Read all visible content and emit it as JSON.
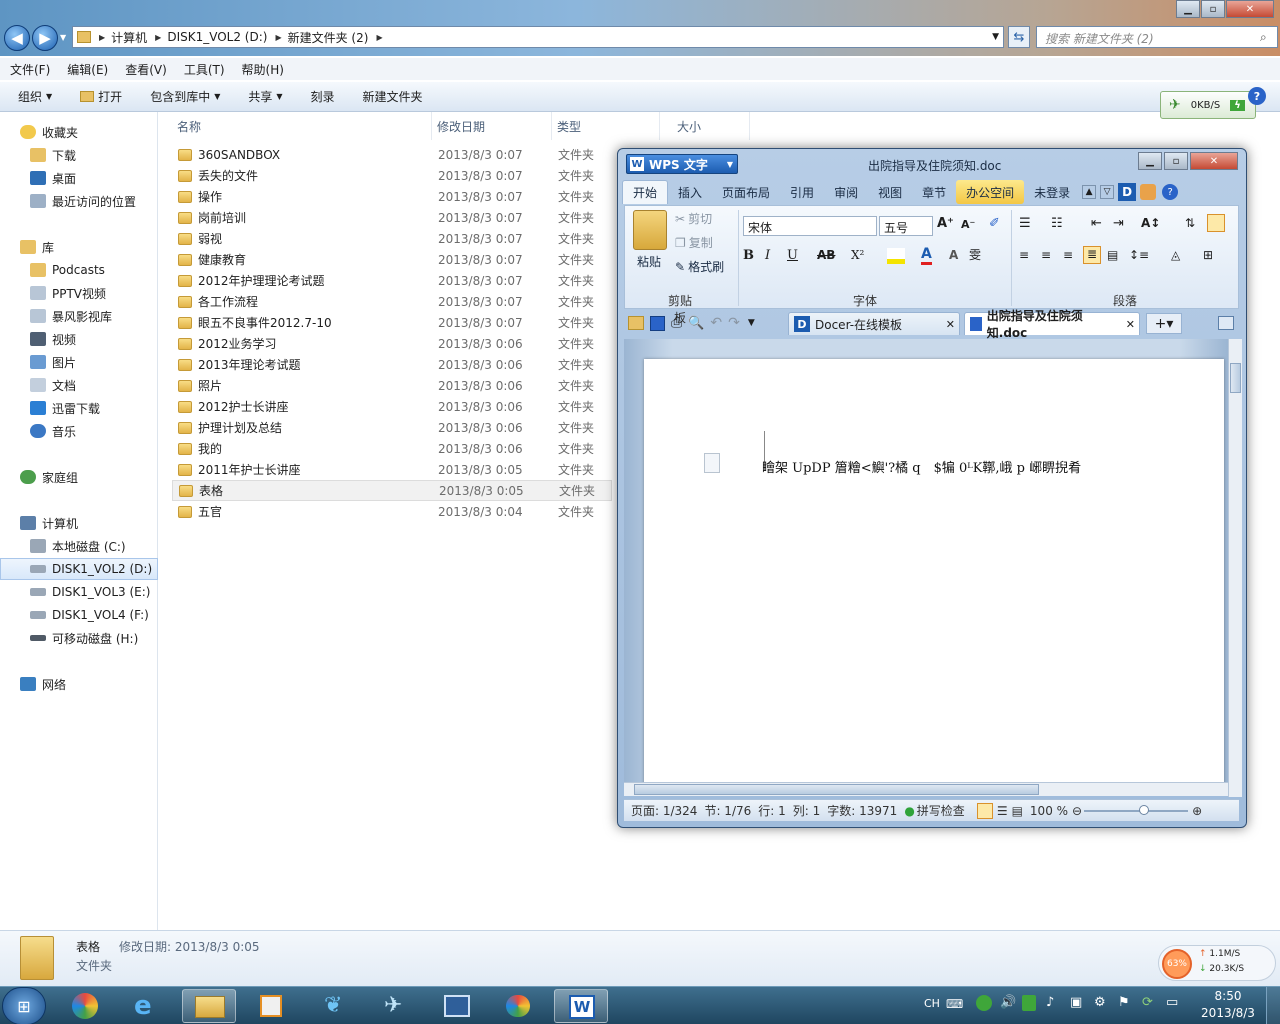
{
  "explorer": {
    "address": [
      "计算机",
      "DISK1_VOL2 (D:)",
      "新建文件夹 (2)"
    ],
    "search_placeholder": "搜索 新建文件夹 (2)",
    "menu": [
      "文件(F)",
      "编辑(E)",
      "查看(V)",
      "工具(T)",
      "帮助(H)"
    ],
    "commands": {
      "organize": "组织",
      "open": "打开",
      "include": "包含到库中",
      "share": "共享",
      "burn": "刻录",
      "new_folder": "新建文件夹"
    },
    "nav": {
      "favorites": "收藏夹",
      "downloads": "下载",
      "desktop": "桌面",
      "recent": "最近访问的位置",
      "libraries": "库",
      "podcasts": "Podcasts",
      "pptv": "PPTV视频",
      "baofeng": "暴风影视库",
      "videos": "视频",
      "pictures": "图片",
      "documents": "文档",
      "xunlei": "迅雷下载",
      "music": "音乐",
      "homegroup": "家庭组",
      "computer": "计算机",
      "drive_c": "本地磁盘 (C:)",
      "drive_d": "DISK1_VOL2 (D:)",
      "drive_e": "DISK1_VOL3 (E:)",
      "drive_f": "DISK1_VOL4 (F:)",
      "drive_h": "可移动磁盘 (H:)",
      "network": "网络"
    },
    "columns": {
      "name": "名称",
      "date": "修改日期",
      "type": "类型",
      "size": "大小"
    },
    "files": [
      {
        "name": "360SANDBOX",
        "date": "2013/8/3 0:07",
        "type": "文件夹"
      },
      {
        "name": "丢失的文件",
        "date": "2013/8/3 0:07",
        "type": "文件夹"
      },
      {
        "name": "操作",
        "date": "2013/8/3 0:07",
        "type": "文件夹"
      },
      {
        "name": "岗前培训",
        "date": "2013/8/3 0:07",
        "type": "文件夹"
      },
      {
        "name": "弱视",
        "date": "2013/8/3 0:07",
        "type": "文件夹"
      },
      {
        "name": "健康教育",
        "date": "2013/8/3 0:07",
        "type": "文件夹"
      },
      {
        "name": "2012年护理理论考试题",
        "date": "2013/8/3 0:07",
        "type": "文件夹"
      },
      {
        "name": "各工作流程",
        "date": "2013/8/3 0:07",
        "type": "文件夹"
      },
      {
        "name": "眼五不良事件2012.7-10",
        "date": "2013/8/3 0:07",
        "type": "文件夹"
      },
      {
        "name": "2012业务学习",
        "date": "2013/8/3 0:06",
        "type": "文件夹"
      },
      {
        "name": "2013年理论考试题",
        "date": "2013/8/3 0:06",
        "type": "文件夹"
      },
      {
        "name": "照片",
        "date": "2013/8/3 0:06",
        "type": "文件夹"
      },
      {
        "name": "2012护士长讲座",
        "date": "2013/8/3 0:06",
        "type": "文件夹"
      },
      {
        "name": "护理计划及总结",
        "date": "2013/8/3 0:06",
        "type": "文件夹"
      },
      {
        "name": "我的",
        "date": "2013/8/3 0:06",
        "type": "文件夹"
      },
      {
        "name": "2011年护士长讲座",
        "date": "2013/8/3 0:05",
        "type": "文件夹"
      },
      {
        "name": "表格",
        "date": "2013/8/3 0:05",
        "type": "文件夹"
      },
      {
        "name": "五官",
        "date": "2013/8/3 0:04",
        "type": "文件夹"
      }
    ],
    "details": {
      "name": "表格",
      "date_label": "修改日期: 2013/8/3 0:05",
      "type": "文件夹"
    },
    "speed_widget": "0KB/S"
  },
  "wps": {
    "brand": "WPS 文字",
    "title": "出院指导及住院须知.doc",
    "tabs": [
      "开始",
      "插入",
      "页面布局",
      "引用",
      "审阅",
      "视图",
      "章节",
      "办公空间"
    ],
    "login": "未登录",
    "clipboard": {
      "paste": "粘贴",
      "cut": "剪切",
      "copy": "复制",
      "format_painter": "格式刷",
      "group": "剪贴板"
    },
    "font": {
      "name": "宋体",
      "size": "五号",
      "group": "字体"
    },
    "paragraph_group": "段落",
    "doc_tabs": [
      "Docer-在线模板",
      "出院指导及住院须知.doc"
    ],
    "page_text": "瞺架 UpDP 篃糩<鱮'?橘 q　$犏 0ᴸK鞹,峨 p 峫睤掜肴",
    "status": {
      "page": "页面: 1/324",
      "section": "节: 1/76",
      "line": "行: 1",
      "col": "列: 1",
      "words": "字数: 13971",
      "spell": "拼写检查",
      "zoom": "100 %"
    }
  },
  "taskbar": {
    "clock_time": "8:50",
    "clock_date": "2013/8/3",
    "ime": "CH",
    "net_up": "1.1M/S",
    "net_down": "20.3K/S",
    "mem": "63%"
  },
  "colors": {
    "selection": "#cde3f8",
    "wps_accent": "#1c5cb0",
    "taskbar": "#2a5675"
  }
}
